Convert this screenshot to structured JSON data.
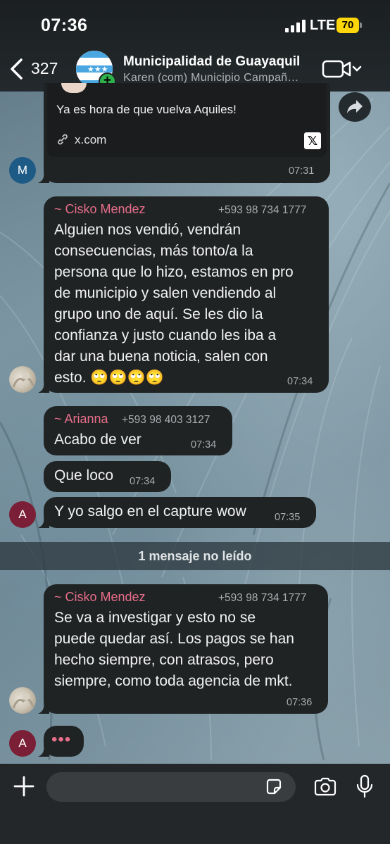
{
  "status_bar": {
    "time": "07:36",
    "network": "LTE",
    "battery": "70"
  },
  "header": {
    "back_count": "327",
    "title": "Municipalidad de Guayaquil",
    "subtitle": "Karen (com) Municipio Campañ…",
    "icons": [
      "chevron-left-icon",
      "video-call-icon",
      "chevron-down-icon"
    ]
  },
  "messages": {
    "link_preview": {
      "text": "Ya es hora de que vuelva Aquiles!",
      "domain": "x.com",
      "time": "07:31",
      "avatar_letter": "M"
    },
    "m1": {
      "sender": "~ Cisko Mendez",
      "phone": "+593 98 734 1777",
      "lines": [
        "Alguien nos vendió, vendrán",
        "consecuencias, más tonto/a la",
        "persona que lo hizo, estamos en pro",
        "de municipio y salen vendiendo al",
        "grupo uno de aquí. Se les dio la",
        "confianza y justo cuando les iba a",
        "dar una buena noticia, salen con",
        "esto. 🙄🙄🙄🙄"
      ],
      "time": "07:34"
    },
    "m2": {
      "sender": "~ Arianna",
      "phone": "+593 98 403 3127",
      "text": "Acabo de ver",
      "time": "07:34"
    },
    "m3": {
      "text": "Que loco",
      "time": "07:34"
    },
    "m4": {
      "text": "Y yo salgo en el capture wow",
      "time": "07:35",
      "avatar_letter": "A"
    },
    "unread_divider": "1 mensaje no leído",
    "m5": {
      "sender": "~ Cisko Mendez",
      "phone": "+593 98 734 1777",
      "lines": [
        "Se va a investigar y esto no se",
        "puede quedar así. Los pagos se han",
        "hecho siempre, con atrasos, pero",
        "siempre, como toda agencia de mkt."
      ],
      "time": "07:36"
    },
    "typing": {
      "avatar_letter": "A",
      "dots": "•••"
    }
  },
  "composer": {
    "placeholder": ""
  },
  "colors": {
    "sender_name": "#e76e8a",
    "bubble": "#202324",
    "avatar_m": "#1d5a86",
    "avatar_a": "#7a1f35",
    "battery": "#ffd60a"
  }
}
